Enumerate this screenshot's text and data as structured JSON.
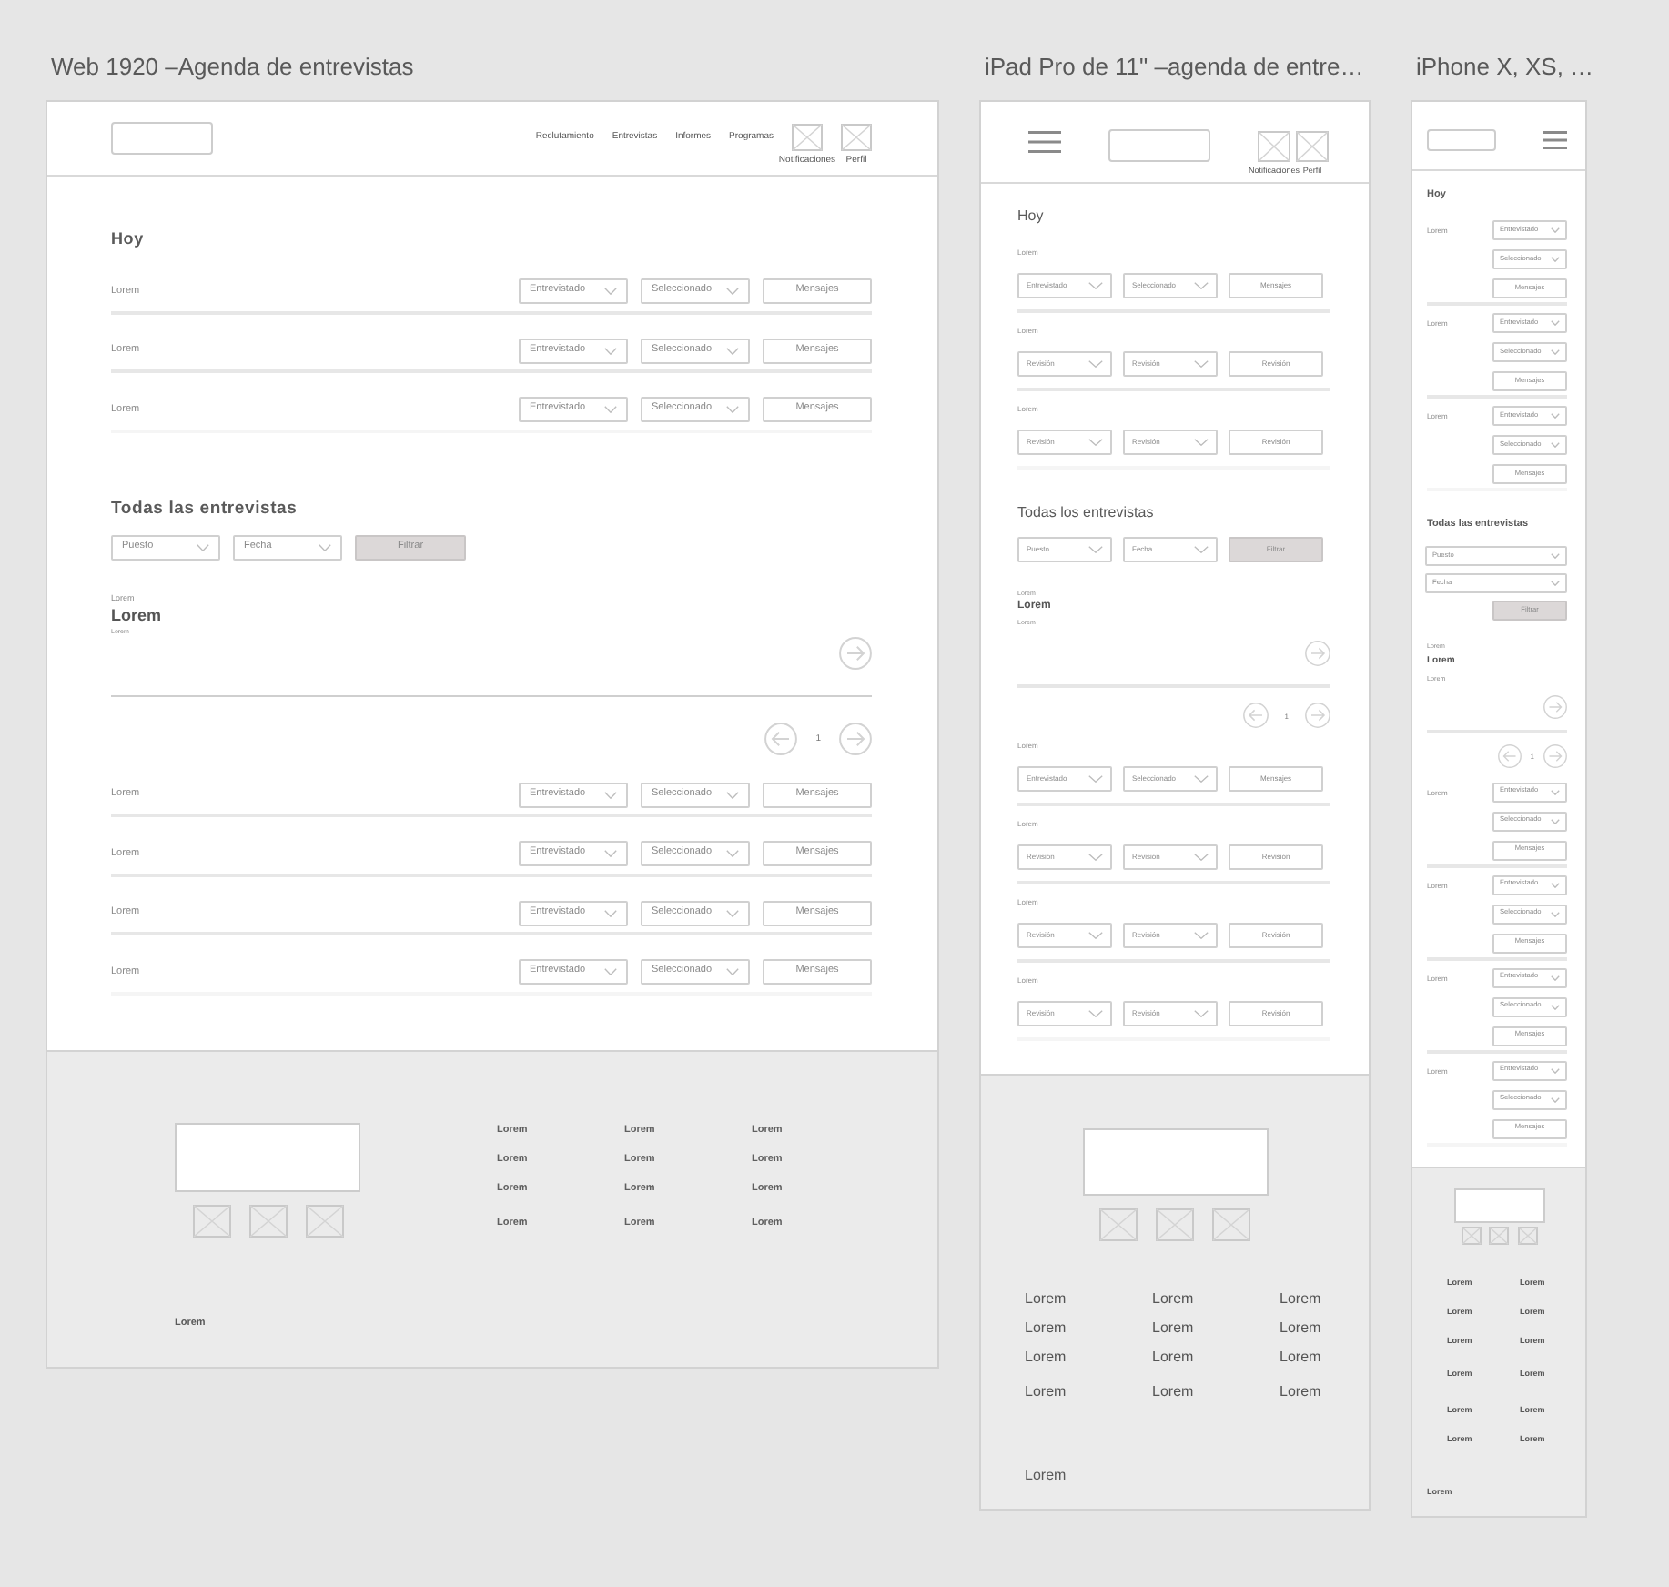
{
  "artboards": [
    {
      "kind": "desktop",
      "title": "Web 1920 –Agenda de entrevistas",
      "header": {
        "nav_links": [
          "Reclutamiento",
          "Entrevistas",
          "Informes",
          "Programas"
        ],
        "icon_labels": [
          "Notificaciones",
          "Perfil"
        ]
      },
      "today": {
        "heading": "Hoy",
        "rows": [
          {
            "name": "Lorem",
            "status": "Entrevistado",
            "stage": "Seleccionado",
            "action": "Mensajes"
          },
          {
            "name": "Lorem",
            "status": "Entrevistado",
            "stage": "Seleccionado",
            "action": "Mensajes"
          },
          {
            "name": "Lorem",
            "status": "Entrevistado",
            "stage": "Seleccionado",
            "action": "Mensajes"
          }
        ]
      },
      "all_interviews": {
        "heading": "Todas las entrevistas",
        "filters": [
          "Puesto",
          "Fecha"
        ],
        "filter_button": "Filtrar",
        "card": {
          "overline": "Lorem",
          "title": "Lorem",
          "subtitle": "Lorem"
        },
        "page": "1",
        "rows": [
          {
            "name": "Lorem",
            "status": "Entrevistado",
            "stage": "Seleccionado",
            "action": "Mensajes"
          },
          {
            "name": "Lorem",
            "status": "Entrevistado",
            "stage": "Seleccionado",
            "action": "Mensajes"
          },
          {
            "name": "Lorem",
            "status": "Entrevistado",
            "stage": "Seleccionado",
            "action": "Mensajes"
          },
          {
            "name": "Lorem",
            "status": "Entrevistado",
            "stage": "Seleccionado",
            "action": "Mensajes"
          }
        ]
      },
      "footer": {
        "link_columns": [
          [
            "Lorem",
            "Lorem",
            "Lorem",
            "Lorem"
          ],
          [
            "Lorem",
            "Lorem",
            "Lorem",
            "Lorem"
          ],
          [
            "Lorem",
            "Lorem",
            "Lorem",
            "Lorem"
          ]
        ],
        "bottom_text": "Lorem"
      }
    },
    {
      "kind": "tablet",
      "title": "iPad Pro de 11\" –agenda de entre…",
      "header": {
        "icon_labels": [
          "Notificaciones",
          "Perfil"
        ]
      },
      "today": {
        "heading": "Hoy",
        "rows": [
          {
            "name": "Lorem",
            "status": "Entrevistado",
            "stage": "Seleccionado",
            "action": "Mensajes"
          },
          {
            "name": "Lorem",
            "status": "Revisión",
            "stage": "Revisión",
            "action": "Revisión"
          },
          {
            "name": "Lorem",
            "status": "Revisión",
            "stage": "Revisión",
            "action": "Revisión"
          }
        ]
      },
      "all_interviews": {
        "heading": "Todas los entrevistas",
        "filters": [
          "Puesto",
          "Fecha"
        ],
        "filter_button": "Filtrar",
        "card": {
          "overline": "Lorem",
          "title": "Lorem",
          "subtitle": "Lorem"
        },
        "page": "1",
        "rows": [
          {
            "name": "Lorem",
            "status": "Entrevistado",
            "stage": "Seleccionado",
            "action": "Mensajes"
          },
          {
            "name": "Lorem",
            "status": "Revisión",
            "stage": "Revisión",
            "action": "Revisión"
          },
          {
            "name": "Lorem",
            "status": "Revisión",
            "stage": "Revisión",
            "action": "Revisión"
          },
          {
            "name": "Lorem",
            "status": "Revisión",
            "stage": "Revisión",
            "action": "Revisión"
          }
        ]
      },
      "footer": {
        "link_columns": [
          [
            "Lorem",
            "Lorem",
            "Lorem",
            "Lorem"
          ],
          [
            "Lorem",
            "Lorem",
            "Lorem",
            "Lorem"
          ],
          [
            "Lorem",
            "Lorem",
            "Lorem",
            "Lorem"
          ]
        ],
        "bottom_text": "Lorem"
      }
    },
    {
      "kind": "phone",
      "title": "iPhone X, XS, …",
      "today": {
        "heading": "Hoy",
        "rows": [
          {
            "name": "Lorem",
            "status": "Entrevistado",
            "stage": "Seleccionado",
            "action": "Mensajes"
          },
          {
            "name": "Lorem",
            "status": "Entrevistado",
            "stage": "Seleccionado",
            "action": "Mensajes"
          },
          {
            "name": "Lorem",
            "status": "Entrevistado",
            "stage": "Seleccionado",
            "action": "Mensajes"
          }
        ]
      },
      "all_interviews": {
        "heading": "Todas las entrevistas",
        "filters": [
          "Puesto",
          "Fecha"
        ],
        "filter_button": "Filtrar",
        "card": {
          "overline": "Lorem",
          "title": "Lorem",
          "subtitle": "Lorem"
        },
        "page": "1",
        "rows": [
          {
            "name": "Lorem",
            "status": "Entrevistado",
            "stage": "Seleccionado",
            "action": "Mensajes"
          },
          {
            "name": "Lorem",
            "status": "Entrevistado",
            "stage": "Seleccionado",
            "action": "Mensajes"
          },
          {
            "name": "Lorem",
            "status": "Entrevistado",
            "stage": "Seleccionado",
            "action": "Mensajes"
          },
          {
            "name": "Lorem",
            "status": "Entrevistado",
            "stage": "Seleccionado",
            "action": "Mensajes"
          }
        ]
      },
      "footer": {
        "link_columns": [
          [
            "Lorem",
            "Lorem",
            "Lorem",
            "Lorem",
            "Lorem",
            "Lorem"
          ],
          [
            "Lorem",
            "Lorem",
            "Lorem",
            "Lorem",
            "Lorem",
            "Lorem"
          ]
        ],
        "bottom_text": "Lorem"
      }
    }
  ]
}
